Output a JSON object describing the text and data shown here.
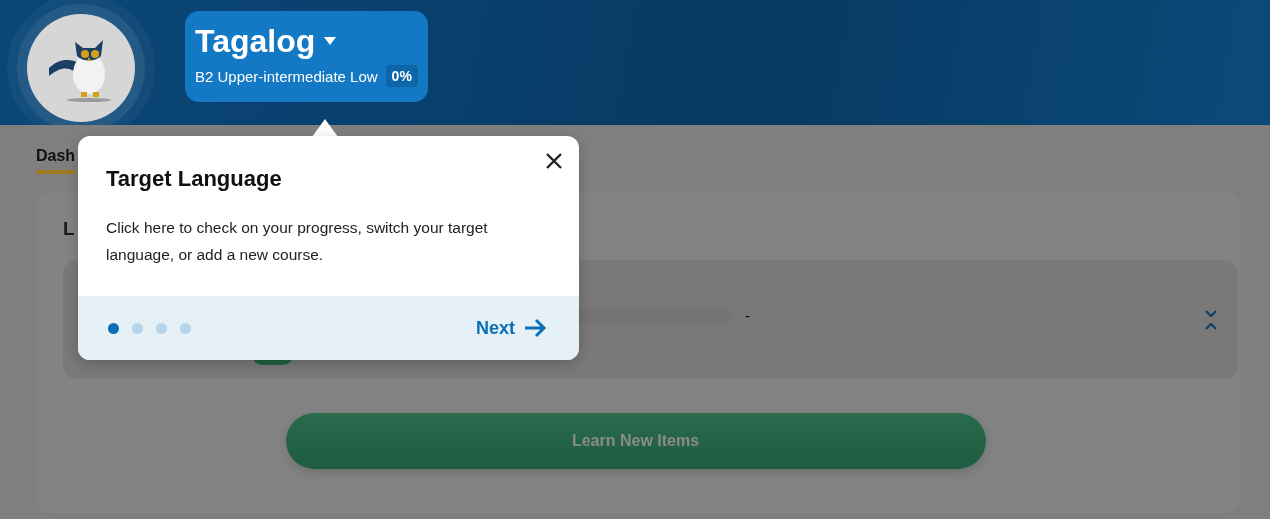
{
  "header": {
    "language": "Tagalog",
    "level": "B2 Upper-intermediate Low",
    "progress": "0%"
  },
  "tabs": [
    {
      "label": "Dash",
      "selected": true
    }
  ],
  "card": {
    "title": "L",
    "rows": [
      {
        "level": 0,
        "reading": "-"
      }
    ],
    "button": "Learn New Items"
  },
  "tour": {
    "title": "Target Language",
    "body": "Click here to check on your progress, switch your target language, or add a new course.",
    "next": "Next",
    "steps": [
      {
        "selected": true
      },
      {
        "selected": false
      },
      {
        "selected": false
      },
      {
        "selected": false
      }
    ]
  }
}
